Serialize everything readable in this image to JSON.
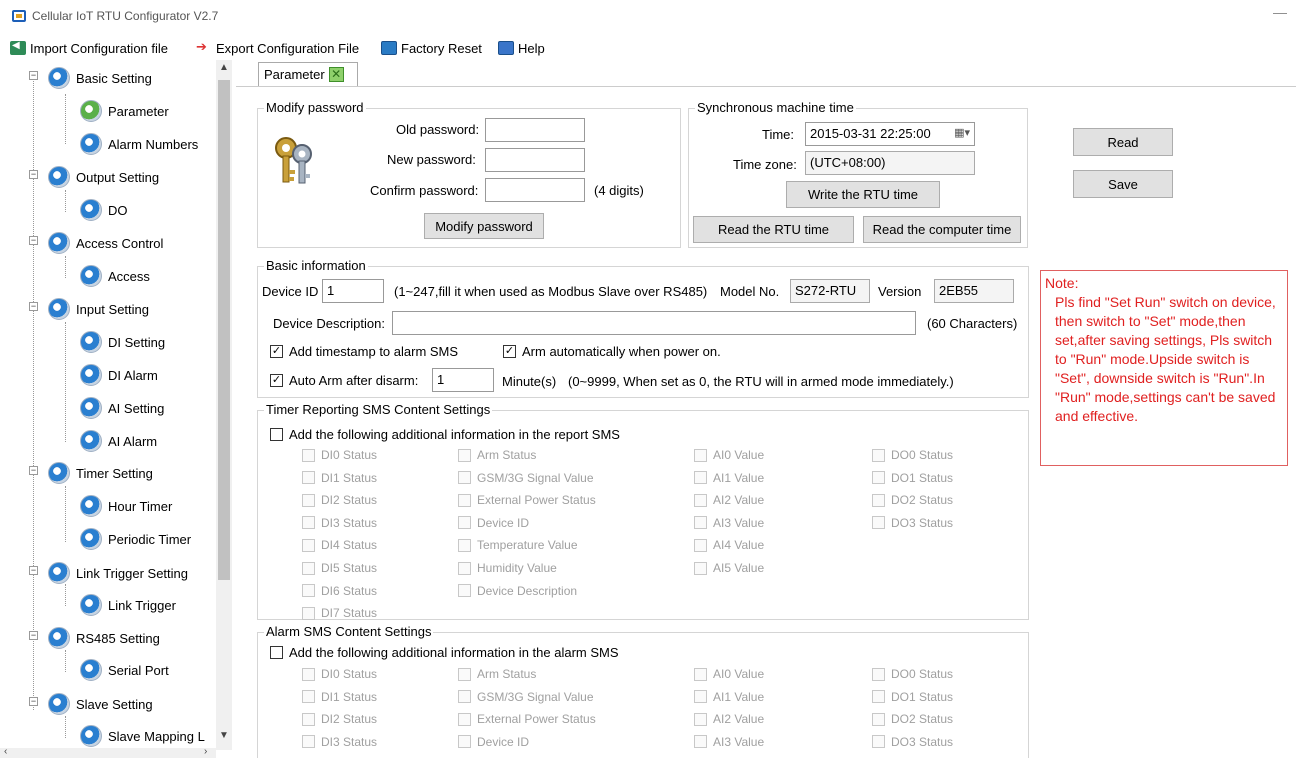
{
  "window": {
    "title": "Cellular IoT RTU Configurator V2.7",
    "minimize": "—"
  },
  "toolbar": {
    "import_label": "Import Configuration file",
    "export_label": "Export Configuration File",
    "factory_label": "Factory Reset",
    "help_label": "Help"
  },
  "tree": {
    "basic": "Basic Setting",
    "parameter": "Parameter",
    "alarm_numbers": "Alarm Numbers",
    "output": "Output Setting",
    "do": "DO",
    "access_control": "Access Control",
    "access": "Access",
    "input": "Input Setting",
    "di_setting": "DI Setting",
    "di_alarm": "DI Alarm",
    "ai_setting": "AI  Setting",
    "ai_alarm": "AI Alarm",
    "timer": "Timer Setting",
    "hour_timer": "Hour Timer",
    "periodic_timer": "Periodic Timer",
    "link_trigger_setting": "Link Trigger Setting",
    "link_trigger": "Link Trigger",
    "rs485": "RS485 Setting",
    "serial_port": "Serial Port",
    "slave": "Slave Setting",
    "slave_mapping": "Slave Mapping L"
  },
  "tab": {
    "label": "Parameter"
  },
  "password": {
    "title": "Modify password",
    "old_label": "Old password:",
    "new_label": "New password:",
    "confirm_label": "Confirm password:",
    "old_value": "",
    "new_value": "",
    "confirm_value": "",
    "hint": "(4 digits)",
    "button": "Modify password"
  },
  "sync": {
    "title": "Synchronous machine time",
    "time_label": "Time:",
    "time_value": "2015-03-31 22:25:00",
    "zone_label": "Time zone:",
    "zone_value": "(UTC+08:00)",
    "write_btn": "Write the RTU time",
    "read_rtu_btn": "Read the RTU time",
    "read_pc_btn": "Read the computer time"
  },
  "actions": {
    "read": "Read",
    "save": "Save"
  },
  "basic": {
    "title": "Basic information",
    "device_id_label": "Device ID",
    "device_id_value": "1",
    "device_id_hint": "(1~247,fill it when used as Modbus Slave over RS485)",
    "model_label": "Model No.",
    "model_value": "S272-RTU",
    "version_label": "Version",
    "version_value": "2EB55",
    "desc_label": "Device Description:",
    "desc_value": "",
    "desc_hint": "(60 Characters)",
    "timestamp_label": "Add timestamp to alarm SMS",
    "arm_power_label": "Arm automatically when power on.",
    "auto_arm_label": "Auto Arm after disarm:",
    "auto_arm_value": "1",
    "minute_label": "Minute(s)",
    "auto_arm_hint": "(0~9999, When set as 0, the RTU will in armed mode immediately.)"
  },
  "timer_sms": {
    "title": "Timer Reporting SMS Content Settings",
    "add_label": "Add the following additional information in the report SMS",
    "col1": [
      "DI0 Status",
      "DI1 Status",
      "DI2 Status",
      "DI3 Status",
      "DI4 Status",
      "DI5 Status",
      "DI6 Status",
      "DI7 Status"
    ],
    "col2": [
      "Arm Status",
      "GSM/3G Signal Value",
      "External Power Status",
      "Device ID",
      "Temperature Value",
      "Humidity Value",
      "Device Description"
    ],
    "col3": [
      "AI0 Value",
      "AI1 Value",
      "AI2 Value",
      "AI3 Value",
      "AI4 Value",
      "AI5 Value"
    ],
    "col4": [
      "DO0 Status",
      "DO1 Status",
      "DO2 Status",
      "DO3 Status"
    ]
  },
  "alarm_sms": {
    "title": "Alarm SMS Content Settings",
    "add_label": "Add the following additional information in the alarm SMS",
    "col1": [
      "DI0 Status",
      "DI1 Status",
      "DI2 Status",
      "DI3 Status"
    ],
    "col2": [
      "Arm Status",
      "GSM/3G Signal Value",
      "External Power Status",
      "Device ID"
    ],
    "col3": [
      "AI0 Value",
      "AI1 Value",
      "AI2 Value",
      "AI3 Value"
    ],
    "col4": [
      "DO0 Status",
      "DO1 Status",
      "DO2 Status",
      "DO3 Status"
    ]
  },
  "note": {
    "title": "Note:",
    "body": "Pls find \"Set Run\"   switch on device, then switch to \"Set\" mode,then set,after saving settings, Pls switch to \"Run\" mode.Upside switch is \"Set\", downside switch is  \"Run\".In \"Run\" mode,settings can't  be saved and  effective."
  },
  "colors": {
    "note_red": "#e02020",
    "accent_blue": "#2a7fd0",
    "tab_green": "#8ed06b"
  }
}
